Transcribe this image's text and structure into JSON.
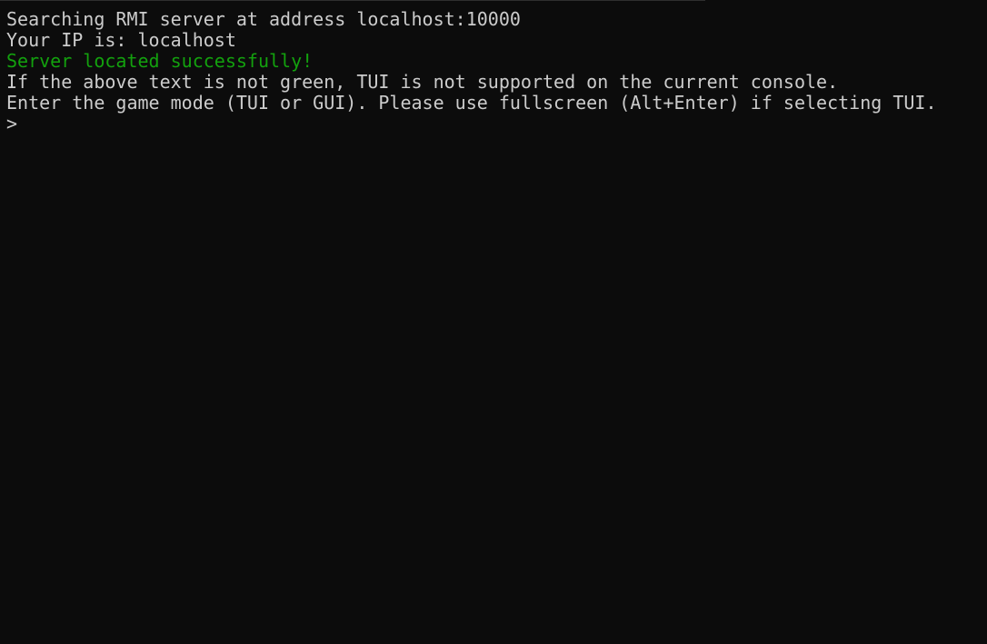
{
  "console": {
    "lines": [
      {
        "text": "Searching RMI server at address localhost:10000",
        "color": "#cccccc"
      },
      {
        "text": "Your IP is: localhost",
        "color": "#cccccc"
      },
      {
        "text": "Server located successfully!",
        "color": "#13a10e"
      },
      {
        "text": "If the above text is not green, TUI is not supported on the current console.",
        "color": "#cccccc"
      },
      {
        "text": "Enter the game mode (TUI or GUI). Please use fullscreen (Alt+Enter) if selecting TUI.",
        "color": "#cccccc"
      }
    ],
    "prompt": {
      "symbol": ">",
      "value": ""
    },
    "colors": {
      "background": "#0c0c0c",
      "foreground": "#cccccc",
      "success": "#13a10e"
    }
  }
}
